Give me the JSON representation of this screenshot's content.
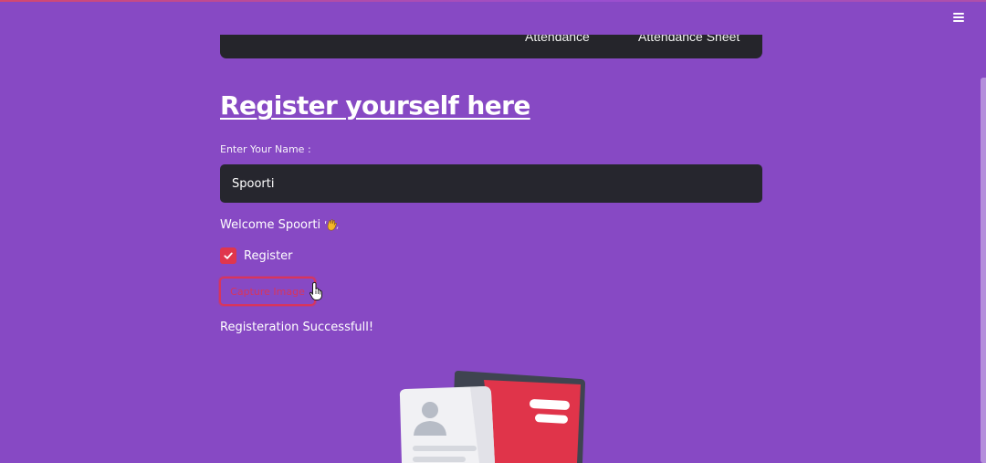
{
  "nav": {
    "items": [
      "Attendance",
      "Attendance Sheet"
    ]
  },
  "header": {
    "menu_icon": "hamburger-menu-icon"
  },
  "main": {
    "title": "Register yourself here",
    "name_label": "Enter Your Name :",
    "name_value": "Spoorti",
    "welcome_text": "Welcome Spoorti",
    "welcome_icon": "waving-hand-icon",
    "register_checkbox": {
      "label": "Register",
      "checked": true
    },
    "capture_button_label": "Capture Image",
    "status_message": "Registeration Successfull!",
    "illustration_icon": "id-cards-illustration"
  },
  "colors": {
    "background": "#8749c4",
    "accent": "#e0364d",
    "input_background": "#26262e",
    "navbar_background": "#25252b"
  }
}
